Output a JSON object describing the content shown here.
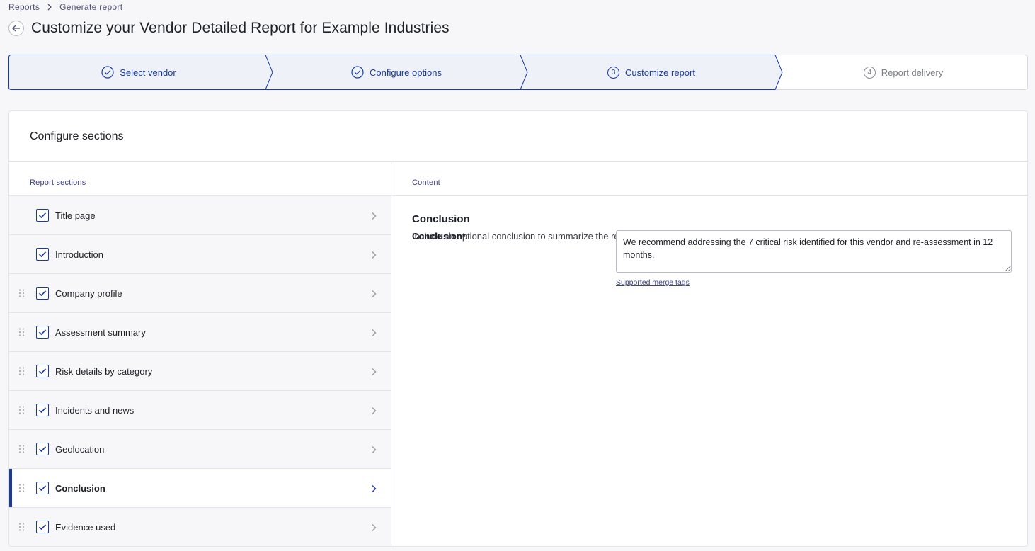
{
  "breadcrumb": {
    "items": [
      "Reports",
      "Generate report"
    ]
  },
  "page": {
    "title": "Customize your Vendor Detailed Report for Example Industries"
  },
  "stepper": {
    "steps": [
      {
        "label": "Select vendor",
        "state": "complete",
        "icon": "check-circle-icon"
      },
      {
        "label": "Configure options",
        "state": "complete",
        "icon": "check-circle-icon"
      },
      {
        "label": "Customize report",
        "state": "current",
        "number": "3"
      },
      {
        "label": "Report delivery",
        "state": "upcoming",
        "number": "4"
      }
    ]
  },
  "card": {
    "title": "Configure sections",
    "left_label": "Report sections",
    "right_label": "Content"
  },
  "sections": [
    {
      "label": "Title page",
      "checked": true,
      "draggable": false
    },
    {
      "label": "Introduction",
      "checked": true,
      "draggable": false
    },
    {
      "label": "Company profile",
      "checked": true,
      "draggable": true
    },
    {
      "label": "Assessment summary",
      "checked": true,
      "draggable": true
    },
    {
      "label": "Risk details by category",
      "checked": true,
      "draggable": true
    },
    {
      "label": "Incidents and news",
      "checked": true,
      "draggable": true
    },
    {
      "label": "Geolocation",
      "checked": true,
      "draggable": true
    },
    {
      "label": "Conclusion",
      "checked": true,
      "draggable": true,
      "active": true
    },
    {
      "label": "Evidence used",
      "checked": true,
      "draggable": true
    }
  ],
  "content": {
    "title": "Conclusion",
    "description": "Include an optional conclusion to summarize the report findings.",
    "field_label": "Conclusion*",
    "field_value": "We recommend addressing the 7 critical risk identified for this vendor and re-assessment in 12 months.",
    "merge_tags_link": "Supported merge tags"
  },
  "colors": {
    "accent": "#1a3b9c",
    "step_bg": "#eef1f8",
    "page_bg": "#f7f7f9"
  }
}
